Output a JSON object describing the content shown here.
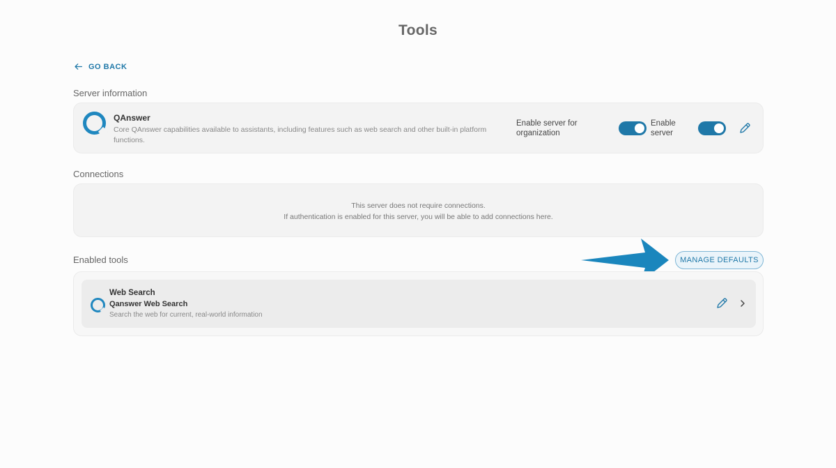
{
  "page": {
    "title": "Tools"
  },
  "nav": {
    "go_back_label": "GO BACK"
  },
  "server_info": {
    "section_label": "Server information",
    "name": "QAnswer",
    "description": "Core QAnswer capabilities available to assistants, including features such as web search and other built-in platform functions.",
    "org_toggle_label": "Enable server for organization",
    "org_toggle_on": true,
    "server_toggle_label": "Enable server",
    "server_toggle_on": true
  },
  "connections": {
    "section_label": "Connections",
    "message_line1": "This server does not require connections.",
    "message_line2": "If authentication is enabled for this server, you will be able to add connections here."
  },
  "enabled_tools": {
    "section_label": "Enabled tools",
    "manage_defaults_label": "MANAGE DEFAULTS",
    "tools": [
      {
        "title": "Web Search",
        "subtitle": "Qanswer Web Search",
        "description": "Search the web for current, real-world information"
      }
    ]
  },
  "colors": {
    "accent": "#1f78a8",
    "logo": "#1f87bf",
    "annotation_arrow": "#1a86bd"
  },
  "icons": {
    "back": "arrow-left-icon",
    "edit": "pencil-icon",
    "chevron": "chevron-right-icon",
    "logo": "qanswer-logo-icon"
  }
}
